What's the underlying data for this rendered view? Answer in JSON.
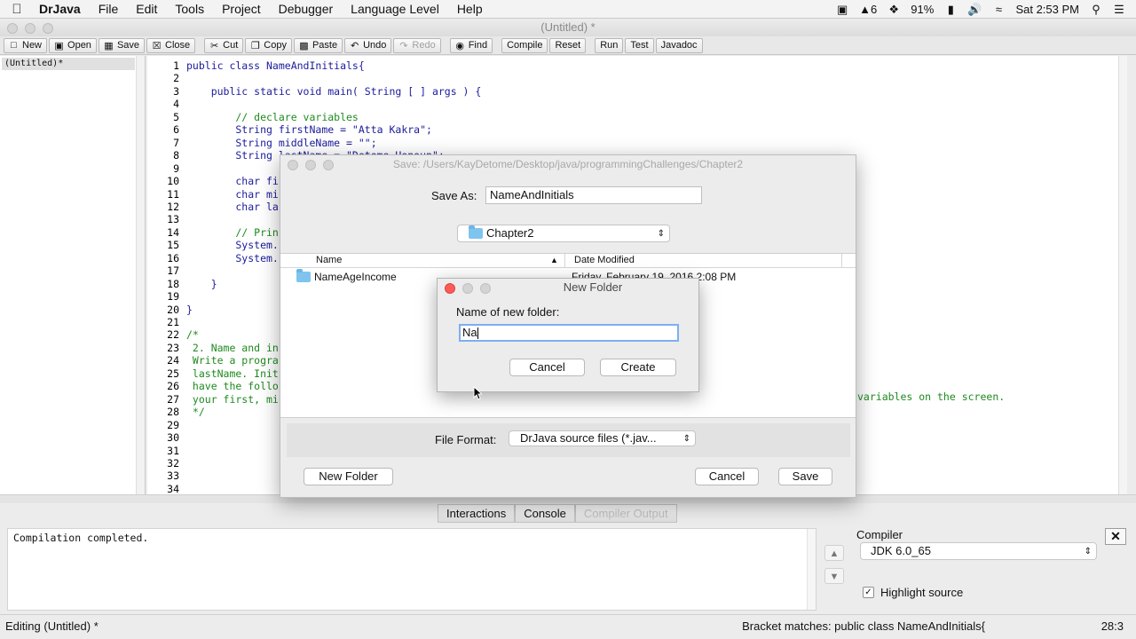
{
  "menubar": {
    "apple": "",
    "app_name": "DrJava",
    "menus": [
      "File",
      "Edit",
      "Tools",
      "Project",
      "Debugger",
      "Language Level",
      "Help"
    ],
    "status_adobe": "6",
    "battery": "91%",
    "clock": "Sat 2:53 PM"
  },
  "window": {
    "title": "(Untitled) *"
  },
  "toolbar": {
    "new": "New",
    "open": "Open",
    "save": "Save",
    "close": "Close",
    "cut": "Cut",
    "copy": "Copy",
    "paste": "Paste",
    "undo": "Undo",
    "redo": "Redo",
    "find": "Find",
    "compile": "Compile",
    "reset": "Reset",
    "run": "Run",
    "test": "Test",
    "javadoc": "Javadoc"
  },
  "file_list": {
    "current_document": "(Untitled)*"
  },
  "editor": {
    "line_numbers": [
      "1",
      "2",
      "3",
      "4",
      "5",
      "6",
      "7",
      "8",
      "9",
      "10",
      "11",
      "12",
      "13",
      "14",
      "15",
      "16",
      "17",
      "18",
      "19",
      "20",
      "21",
      "22",
      "23",
      "24",
      "25",
      "26",
      "27",
      "28",
      "29",
      "30",
      "31",
      "32",
      "33",
      "34"
    ],
    "lines": [
      {
        "text": "public class NameAndInitials{",
        "kind": "code"
      },
      {
        "text": "",
        "kind": "code"
      },
      {
        "text": "    public static void main( String [ ] args ) {",
        "kind": "code"
      },
      {
        "text": "",
        "kind": "code"
      },
      {
        "text": "        // declare variables",
        "kind": "cmt"
      },
      {
        "text": "        String firstName = \"Atta Kakra\";",
        "kind": "code"
      },
      {
        "text": "        String middleName = \"\";",
        "kind": "code"
      },
      {
        "text": "        String lastName = \"Detome Honoun\";",
        "kind": "code"
      },
      {
        "text": "",
        "kind": "code"
      },
      {
        "text": "        char fi",
        "kind": "code"
      },
      {
        "text": "        char mi",
        "kind": "code"
      },
      {
        "text": "        char la",
        "kind": "code"
      },
      {
        "text": "",
        "kind": "code"
      },
      {
        "text": "        // Prin",
        "kind": "cmt"
      },
      {
        "text": "        System.",
        "kind": "code"
      },
      {
        "text": "        System.",
        "kind": "code"
      },
      {
        "text": "",
        "kind": "code"
      },
      {
        "text": "    }",
        "kind": "code"
      },
      {
        "text": "",
        "kind": "code"
      },
      {
        "text": "}",
        "kind": "code"
      },
      {
        "text": "",
        "kind": "code"
      },
      {
        "text": "/*",
        "kind": "cmt"
      },
      {
        "text": " 2. Name and in",
        "kind": "cmt"
      },
      {
        "text": " Write a progra",
        "kind": "cmt"
      },
      {
        "text": " lastName. Init",
        "kind": "cmt"
      },
      {
        "text": " have the follo",
        "kind": "cmt"
      },
      {
        "text": " your first, mi",
        "kind": "cmt"
      },
      {
        "text": " */",
        "kind": "cmt"
      },
      {
        "text": "",
        "kind": "code"
      },
      {
        "text": "",
        "kind": "code"
      },
      {
        "text": "",
        "kind": "code"
      },
      {
        "text": "",
        "kind": "code"
      },
      {
        "text": "",
        "kind": "code"
      },
      {
        "text": "",
        "kind": "code"
      }
    ],
    "overflow_line_27": "variables on the screen."
  },
  "bottom": {
    "tabs": [
      "Interactions",
      "Console",
      "Compiler Output"
    ],
    "console_text": "Compilation completed.",
    "compiler_label": "Compiler",
    "compiler_value": "JDK 6.0_65",
    "highlight_label": "Highlight source",
    "close_glyph": "✕"
  },
  "status": {
    "left": "Editing (Untitled) *",
    "middle": "Bracket matches: public class NameAndInitials{",
    "position": "28:3"
  },
  "save_dialog": {
    "title": "Save:  /Users/KayDetome/Desktop/java/programmingChallenges/Chapter2",
    "save_as_label": "Save As:",
    "save_as_value": "NameAndInitials",
    "folder": "Chapter2",
    "col_name": "Name",
    "col_date": "Date Modified",
    "rows": [
      {
        "name": "NameAgeIncome",
        "date": "Friday, February 19, 2016 2:08 PM"
      }
    ],
    "file_format_label": "File Format:",
    "file_format_value": "DrJava source files (*.jav...",
    "new_folder_button": "New Folder",
    "cancel_button": "Cancel",
    "save_button": "Save"
  },
  "new_folder_dialog": {
    "title": "New Folder",
    "prompt": "Name of new folder:",
    "input_value": "Na",
    "cancel_button": "Cancel",
    "create_button": "Create"
  }
}
